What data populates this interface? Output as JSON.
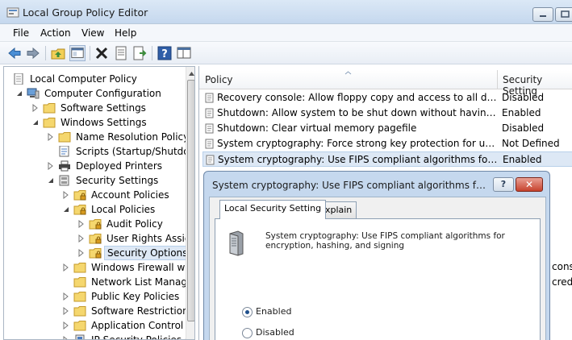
{
  "window": {
    "title": "Local Group Policy Editor",
    "icon": "group-policy-editor-icon",
    "controls": [
      "minimize-icon",
      "maximize-icon"
    ]
  },
  "menu": [
    "File",
    "Action",
    "View",
    "Help"
  ],
  "toolbar": [
    "back-arrow-icon",
    "forward-arrow-icon",
    "up-folder-icon",
    "show-hide-console-tree-icon",
    "delete-icon",
    "properties-icon",
    "export-list-icon",
    "help-icon",
    "extended-view-icon"
  ],
  "tree": {
    "root": "Local Computer Policy",
    "computer_configuration": "Computer Configuration",
    "software_settings": "Software Settings",
    "windows_settings": "Windows Settings",
    "name_resolution_policy": "Name Resolution Policy",
    "scripts": "Scripts (Startup/Shutdow",
    "deployed_printers": "Deployed Printers",
    "security_settings": "Security Settings",
    "account_policies": "Account Policies",
    "local_policies": "Local Policies",
    "audit_policy": "Audit Policy",
    "user_rights": "User Rights Assign",
    "security_options": "Security Options",
    "windows_firewall": "Windows Firewall wit",
    "network_list": "Network List Manage",
    "public_key": "Public Key Policies",
    "software_restriction": "Software Restriction P",
    "application_control": "Application Control P",
    "ip_security": "IP Security Policies or"
  },
  "columns": {
    "policy": "Policy",
    "setting": "Security Setting"
  },
  "rows": [
    {
      "policy": "Recovery console: Allow floppy copy and access to all drives an...",
      "setting": "Disabled"
    },
    {
      "policy": "Shutdown: Allow system to be shut down without having to log...",
      "setting": "Enabled"
    },
    {
      "policy": "Shutdown: Clear virtual memory pagefile",
      "setting": "Disabled"
    },
    {
      "policy": "System cryptography: Force strong key protection for user keys ...",
      "setting": "Not Defined"
    },
    {
      "policy": "System cryptography: Use FIPS compliant algorithms for encryp...",
      "setting": "Enabled"
    }
  ],
  "right_cutoff": [
    "cons",
    "crede"
  ],
  "dialog": {
    "title": "System cryptography: Use FIPS compliant algorithms for encry...",
    "help_label": "?",
    "close_label": "✕",
    "tabs": [
      "Local Security Setting",
      "Explain"
    ],
    "description_line1": "System cryptography: Use FIPS compliant algorithms for",
    "description_line2": "encryption, hashing, and signing",
    "options": [
      {
        "label": "Enabled",
        "checked": true
      },
      {
        "label": "Disabled",
        "checked": false
      }
    ]
  }
}
